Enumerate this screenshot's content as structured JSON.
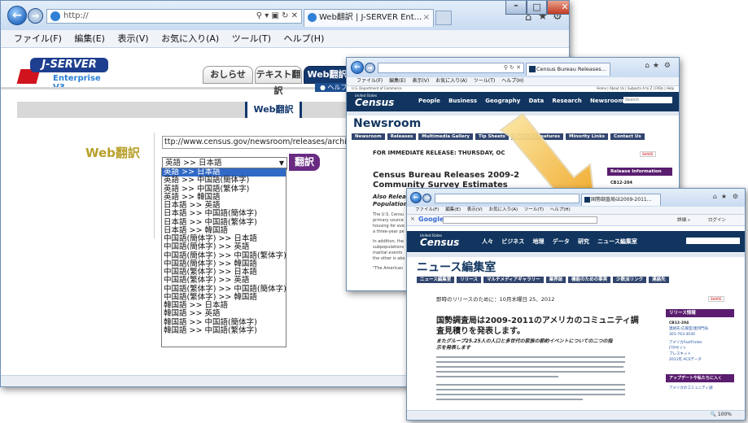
{
  "win1": {
    "address": "http://",
    "tab_title": "Web翻訳 | J-SERVER Ent...",
    "menu": [
      "ファイル(F)",
      "編集(E)",
      "表示(V)",
      "お気に入り(A)",
      "ツール(T)",
      "ヘルプ(H)"
    ],
    "logo_main": "J-SERVER",
    "logo_sub": "Enterprise V3",
    "tabs": [
      "おしらせ",
      "テキスト翻訳",
      "Web翻訳"
    ],
    "help_link": "ヘルプ",
    "section_header": "Web翻訳",
    "form_label": "Web翻訳",
    "url_value": "ttp://www.census.gov/newsroom/releases/archives/americ",
    "select_value": "英語 >> 日本語",
    "translate_button": "翻訳",
    "options": [
      "英語 >> 日本語",
      "英語 >> 中国語(簡体字)",
      "英語 >> 中国語(繁体字)",
      "英語 >> 韓国語",
      "日本語 >> 英語",
      "日本語 >> 中国語(簡体字)",
      "日本語 >> 中国語(繁体字)",
      "日本語 >> 韓国語",
      "中国語(簡体字) >> 日本語",
      "中国語(簡体字) >> 英語",
      "中国語(簡体字) >> 中国語(繁体字)",
      "中国語(簡体字) >> 韓国語",
      "中国語(繁体字) >> 日本語",
      "中国語(繁体字) >> 英語",
      "中国語(繁体字) >> 中国語(簡体字)",
      "中国語(繁体字) >> 韓国語",
      "韓国語 >> 日本語",
      "韓国語 >> 英語",
      "韓国語 >> 中国語(簡体字)",
      "韓国語 >> 中国語(繁体字)"
    ]
  },
  "win2": {
    "tab_title": "Census Bureau Releases...",
    "menu": [
      "ファイル(F)",
      "編集(E)",
      "表示(V)",
      "お気に入り(A)",
      "ツール(T)",
      "ヘルプ(H)"
    ],
    "logo_small": "United States",
    "logo": "Census",
    "logo_bureau": "Bureau",
    "nav": [
      "People",
      "Business",
      "Geography",
      "Data",
      "Research",
      "Newsroom"
    ],
    "search_label": "Search",
    "top_links": "Home | About Us | Subjects A to Z | FAQs | Help",
    "dept": "U.S. Department of Commerce",
    "section_title": "Newsroom",
    "subtabs": [
      "Newsroom",
      "Releases",
      "Multimedia Gallery",
      "Tip Sheets",
      "Facts for Features",
      "Minority Links",
      "Contact Us"
    ],
    "immediate": "FOR IMMEDIATE RELEASE:  THURSDAY, OC",
    "headline": "Census Bureau Releases 2009-2",
    "headline2": "Community Survey Estimates",
    "sub": "Also Relea",
    "sub2": "Population",
    "body1": "The U.S. Censu",
    "body2": "primary source",
    "body3": "housing for eve",
    "body4": "a three-year pe",
    "body5": "In addition, the",
    "body6": "subpopulations",
    "body7": "marital events",
    "body8": "the other is abo",
    "body9": "\"The American",
    "side_header": "Release Information",
    "side_code": "CB12-204",
    "share": "SHARE"
  },
  "win3": {
    "tab_title": "国勢調査局は2009-2011...",
    "menu": [
      "ファイル(F)",
      "編集(E)",
      "表示(V)",
      "お気に入り(A)",
      "ツール(T)",
      "ヘルプ(H)"
    ],
    "google": "Google",
    "toolbar_right": [
      "詳細 »",
      "ログイン"
    ],
    "logo_small": "United States",
    "logo": "Census",
    "logo_bureau": "Bureau",
    "nav": [
      "人々",
      "ビジネス",
      "地理",
      "データ",
      "研究",
      "ニュース編集室"
    ],
    "section_title": "ニュース編集室",
    "subtabs": [
      "ニュース編集室",
      "リリース",
      "マルチメディアギャラリー",
      "業界誌",
      "機能のための事実",
      "少数派リンク",
      "連絡先"
    ],
    "immediate": "即時のリリースのために：10月木曜日 25、2012",
    "headline": "国勢調査局は2009-2011のアメリカのコミュニティ調",
    "headline2": "査見積りを発表します。",
    "sub": "またグループ25.25人の人口と多世代の家族の節約イベントについての二つの指",
    "sub2": "示を発表します",
    "side_header": "リリース情報",
    "side_code": "CB12-204",
    "side_links": [
      "連絡先:広報室/連邦門局",
      "301-763-3030",
      "アメリカFactFinder",
      "FTPサイト",
      "プレスキット",
      "2011年 ACSデータ"
    ],
    "side_header2": "アップデートや私たちに入く",
    "side_link2": "アメリカのコミュニティ調",
    "zoom": "100%",
    "share": "SHARE"
  }
}
